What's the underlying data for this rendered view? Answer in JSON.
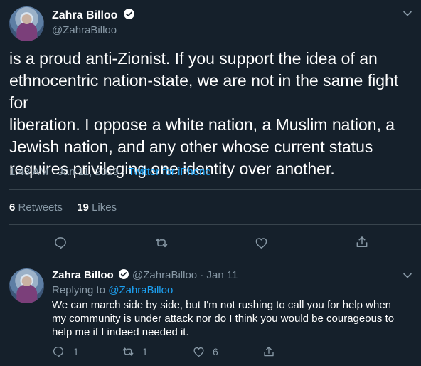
{
  "tweet": {
    "author_name": "Zahra Billoo",
    "author_handle": "@ZahraBilloo",
    "text_lines": [
      "is a proud anti-Zionist. If you support the idea of an",
      "ethnocentric nation-state, we are not in the same fight for",
      "liberation. I oppose a white nation, a Muslim nation, a",
      "Jewish nation, and any other whose current status",
      "requires privileging one identity over another."
    ],
    "timestamp": "1:43 AM · Jan 11, 2019",
    "separator": " · ",
    "source": "Twitter for iPhone",
    "retweets_count": "6",
    "retweets_label": "Retweets",
    "likes_count": "19",
    "likes_label": "Likes"
  },
  "reply": {
    "author_name": "Zahra Billoo",
    "author_handle": "@ZahraBilloo",
    "date": "· Jan 11",
    "replying_label": "Replying to",
    "replying_handle": "@ZahraBilloo",
    "text_lines": [
      "We can march side by side, but I'm not rushing to call you for help when",
      "my community is under attack nor do I think you would be courageous to",
      "help me if I indeed needed it."
    ],
    "reply_count": "1",
    "retweet_count": "1",
    "like_count": "6"
  },
  "colors": {
    "background": "#15202b",
    "accent": "#1da1f2",
    "muted": "#8899a6",
    "divider": "#38444d"
  },
  "icons": [
    "verified-badge-icon",
    "chevron-down-icon",
    "reply-icon",
    "retweet-icon",
    "like-icon",
    "share-icon"
  ]
}
